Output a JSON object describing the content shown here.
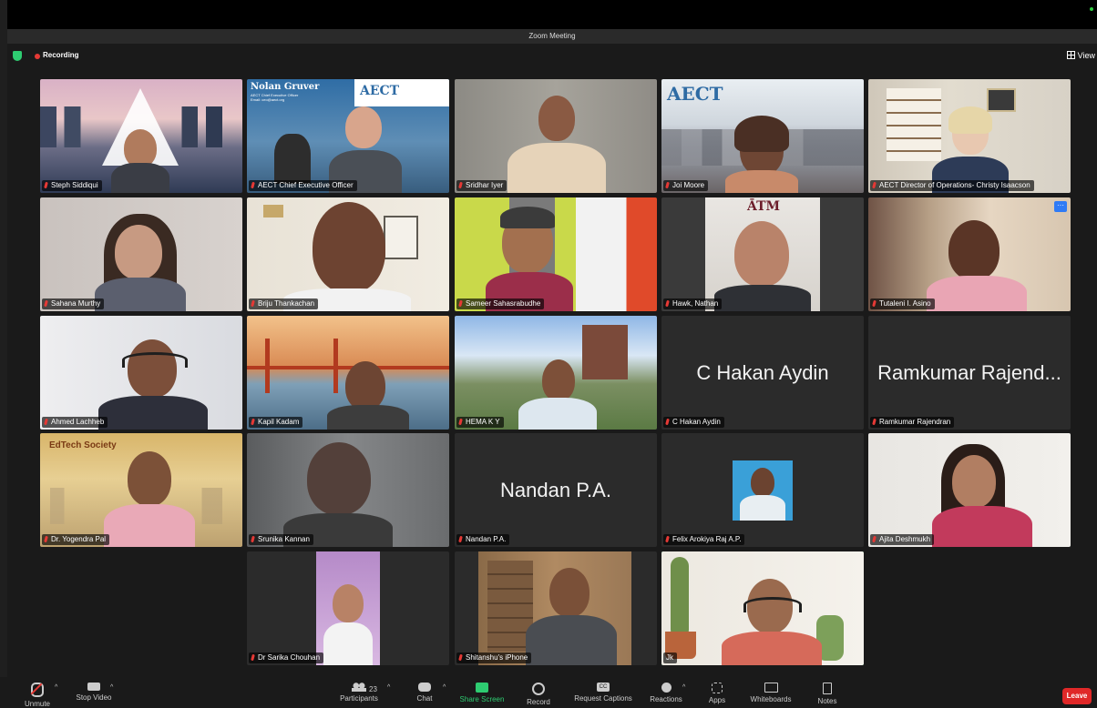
{
  "window": {
    "title": "Zoom Meeting"
  },
  "status": {
    "recording_label": "Recording",
    "view_label": "View"
  },
  "tiles": [
    {
      "name": "Steph Siddiqui"
    },
    {
      "name": "AECT Chief Executive Officer"
    },
    {
      "name": "Sridhar Iyer"
    },
    {
      "name": "Joi Moore"
    },
    {
      "name": "AECT Director of Operations- Christy Isaacson"
    },
    {
      "name": "Sahana Murthy"
    },
    {
      "name": "Briju Thankachan"
    },
    {
      "name": "Sameer Sahasrabudhe"
    },
    {
      "name": "Hawk, Nathan"
    },
    {
      "name": "Tutaleni I. Asino"
    },
    {
      "name": "Ahmed Lachheb"
    },
    {
      "name": "Kapil Kadam"
    },
    {
      "name": "HEMA K Y"
    },
    {
      "name": "C Hakan Aydin",
      "display": "C Hakan Aydin"
    },
    {
      "name": "Ramkumar Rajendran",
      "display": "Ramkumar Rajend..."
    },
    {
      "name": "Dr. Yogendra Pal"
    },
    {
      "name": "Srunika Kannan"
    },
    {
      "name": "Nandan P.A.",
      "display": "Nandan P.A."
    },
    {
      "name": "Felix Arokiya Raj A.P."
    },
    {
      "name": "Ajita Deshmukh"
    },
    {
      "name": "Dr Sarika Chouhan"
    },
    {
      "name": "Shitanshu's iPhone"
    },
    {
      "name": "Jk"
    }
  ],
  "overlays": {
    "nolan_title": "Nolan Gruver",
    "nolan_sub1": "AECT Chief Executive Officer",
    "nolan_sub2": "Email: ceo@aect.org",
    "aect_logo": "AECT",
    "edtech": "EdTech Society",
    "more_badge": "···"
  },
  "toolbar": {
    "unmute": "Unmute",
    "stop_video": "Stop Video",
    "participants": "Participants",
    "participants_count": "23",
    "chat": "Chat",
    "share_screen": "Share Screen",
    "record": "Record",
    "request_captions": "Request Captions",
    "reactions": "Reactions",
    "apps": "Apps",
    "whiteboards": "Whiteboards",
    "notes": "Notes",
    "leave": "Leave"
  },
  "colors": {
    "active_speaker": "#2ecc71",
    "recording": "#e53935",
    "leave": "#e02828",
    "share": "#2ecc71"
  }
}
